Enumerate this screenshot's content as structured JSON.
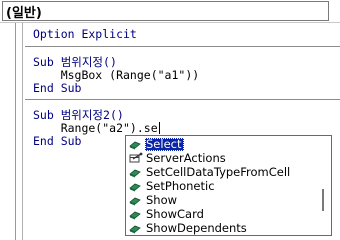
{
  "header": {
    "object_combo": "(일반)"
  },
  "code": {
    "lines": [
      "Option Explicit",
      "Sub 범위지정()",
      "    MsgBox (Range(\"a1\"))",
      "End Sub",
      "Sub 범위지정2()",
      "    Range(\"a2\").se",
      "End Sub"
    ]
  },
  "autocomplete": {
    "selected": "Select",
    "items": [
      {
        "label": "Select",
        "icon": "method-icon"
      },
      {
        "label": "ServerActions",
        "icon": "property-icon"
      },
      {
        "label": "SetCellDataTypeFromCell",
        "icon": "method-icon"
      },
      {
        "label": "SetPhonetic",
        "icon": "method-icon"
      },
      {
        "label": "Show",
        "icon": "method-icon"
      },
      {
        "label": "ShowCard",
        "icon": "method-icon"
      },
      {
        "label": "ShowDependents",
        "icon": "method-icon"
      }
    ]
  },
  "colors": {
    "keyword": "#000080",
    "selection": "#0a24a8",
    "method_icon": "#2e8b57"
  }
}
